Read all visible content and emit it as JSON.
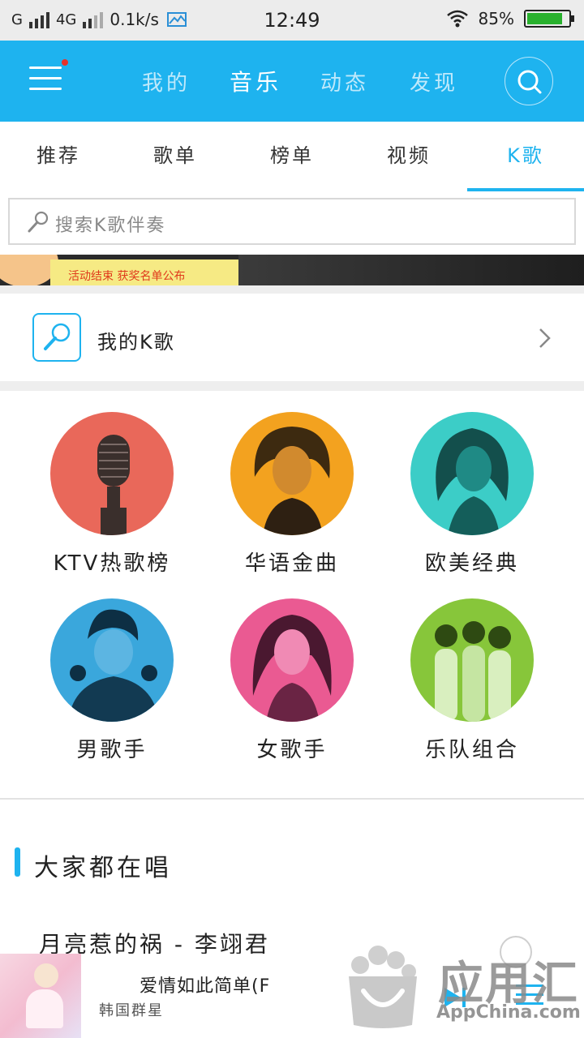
{
  "status_bar": {
    "network_type_1": "G",
    "network_type_2": "4G",
    "speed": "0.1k/s",
    "time": "12:49",
    "battery": "85%",
    "battery_level": 0.85
  },
  "topnav": {
    "items": [
      "我的",
      "音乐",
      "动态",
      "发现"
    ],
    "active_index": 1
  },
  "subtabs": {
    "items": [
      "推荐",
      "歌单",
      "榜单",
      "视频",
      "K歌"
    ],
    "active_index": 4
  },
  "search": {
    "placeholder": "搜索K歌伴奏"
  },
  "banner": {
    "text": "活动结束 获奖名单公布"
  },
  "my_k": {
    "label": "我的K歌"
  },
  "categories": [
    {
      "label": "KTV热歌榜",
      "color": "#e9685a"
    },
    {
      "label": "华语金曲",
      "color": "#f3a21f"
    },
    {
      "label": "欧美经典",
      "color": "#3ccdc7"
    },
    {
      "label": "男歌手",
      "color": "#3aa7dc"
    },
    {
      "label": "女歌手",
      "color": "#ea5a92"
    },
    {
      "label": "乐队组合",
      "color": "#87c63a"
    }
  ],
  "section": {
    "title": "大家都在唱",
    "first_song": "月亮惹的祸 - 李翊君"
  },
  "player": {
    "title": "爱情如此简单(F",
    "artist": "韩国群星"
  },
  "watermark": {
    "cn": "应用汇",
    "en": "AppChina.com"
  },
  "colors": {
    "accent": "#1eb3ef",
    "appbar": "#1eb3ef"
  }
}
